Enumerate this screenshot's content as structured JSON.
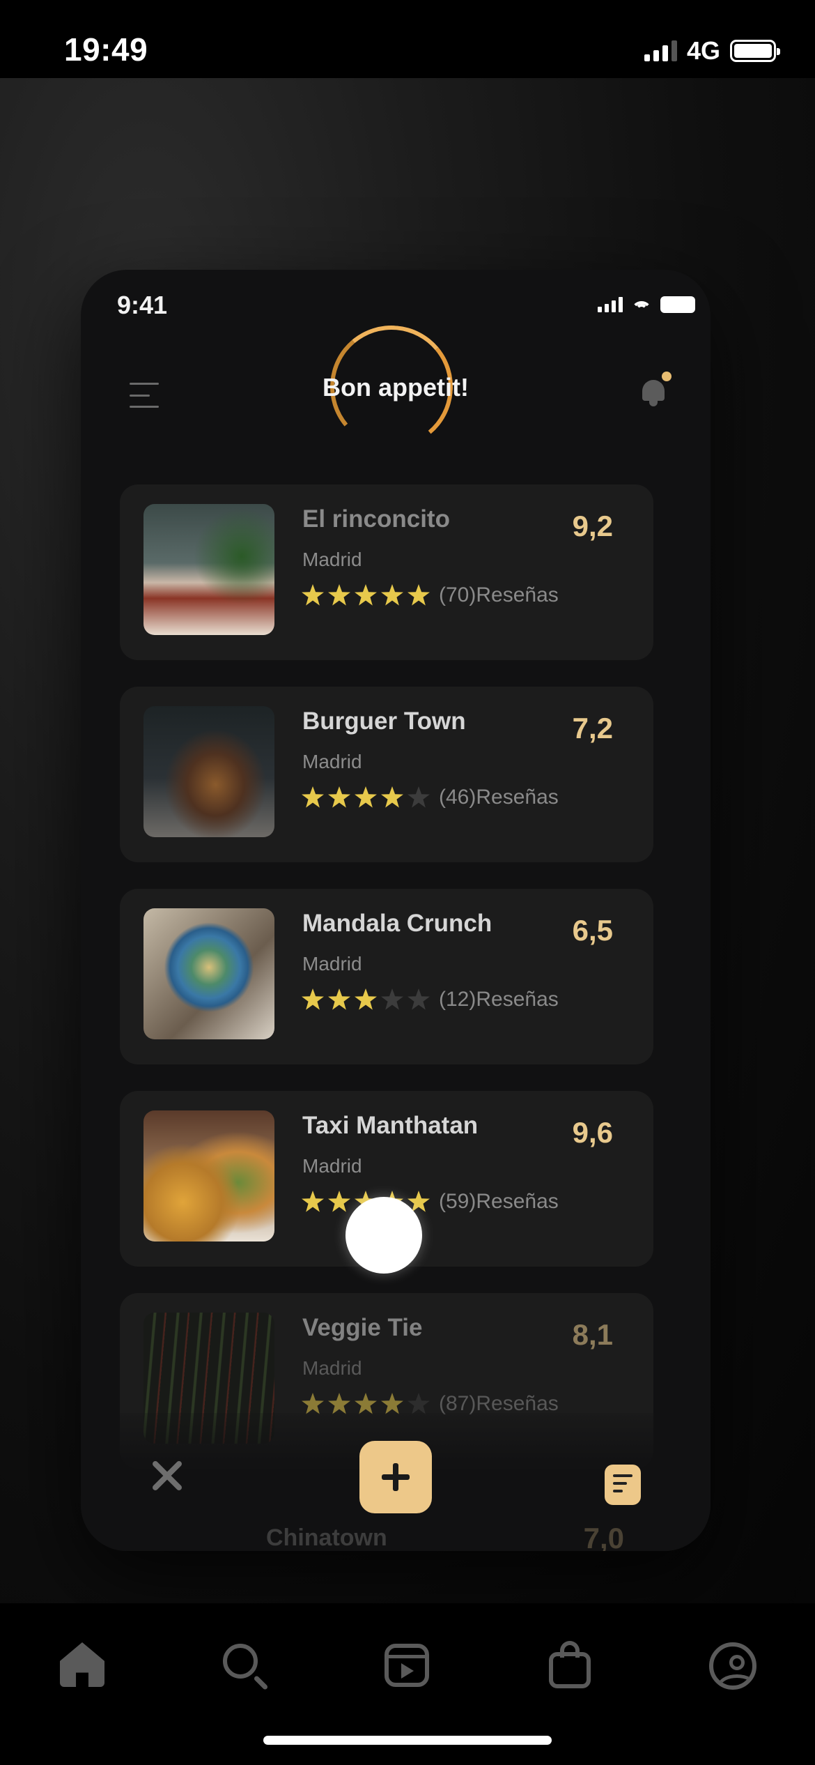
{
  "status_bar": {
    "time": "19:49",
    "network": "4G"
  },
  "inner_app": {
    "time": "9:41",
    "title": "Bon appetit!",
    "restaurants": [
      {
        "name": "El rinconcito",
        "city": "Madrid",
        "rating": 9.2,
        "score": "9,2",
        "stars": 5,
        "reviews": "(70)Reseñas"
      },
      {
        "name": "Burguer Town",
        "city": "Madrid",
        "rating": 7.2,
        "score": "7,2",
        "stars": 4,
        "reviews": "(46)Reseñas"
      },
      {
        "name": "Mandala Crunch",
        "city": "Madrid",
        "rating": 6.5,
        "score": "6,5",
        "stars": 3,
        "reviews": "(12)Reseñas"
      },
      {
        "name": "Taxi Manthatan",
        "city": "Madrid",
        "rating": 9.6,
        "score": "9,6",
        "stars": 5,
        "reviews": "(59)Reseñas"
      },
      {
        "name": "Veggie Tie",
        "city": "Madrid",
        "rating": 8.1,
        "score": "8,1",
        "stars": 4,
        "reviews": "(87)Reseñas"
      }
    ],
    "peek": {
      "name": "Chinatown",
      "score": "7,0"
    },
    "accent_color": "#edc889",
    "star_color": "#e7c94c"
  },
  "bottom_nav": [
    "home-icon",
    "search-icon",
    "reels-icon",
    "shop-icon",
    "profile-icon"
  ]
}
